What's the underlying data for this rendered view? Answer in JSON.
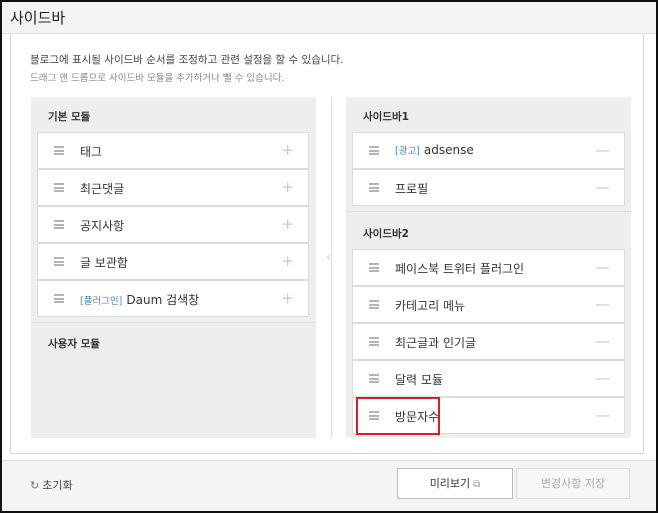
{
  "header": {
    "title": "사이드바"
  },
  "description": {
    "line1": "블로그에 표시될 사이드바 순서를 조정하고 관련 설정을 할 수 있습니다.",
    "line2": "드래그 앤 드롭으로 사이드바 모듈을 추가하거나 뺄 수 있습니다."
  },
  "basic_modules": {
    "label": "기본 모듈",
    "items": [
      {
        "tag": "",
        "label": "태그",
        "action": "+"
      },
      {
        "tag": "",
        "label": "최근댓글",
        "action": "+"
      },
      {
        "tag": "",
        "label": "공지사항",
        "action": "+"
      },
      {
        "tag": "",
        "label": "글 보관함",
        "action": "+"
      },
      {
        "tag": "[플러그인]",
        "label": "Daum 검색창",
        "action": "+"
      }
    ]
  },
  "user_modules": {
    "label": "사용자 모듈"
  },
  "sidebar1": {
    "label": "사이드바1",
    "items": [
      {
        "tag": "[광고]",
        "label": "adsense",
        "action": "—"
      },
      {
        "tag": "",
        "label": "프로필",
        "action": "—"
      }
    ]
  },
  "sidebar2": {
    "label": "사이드바2",
    "items": [
      {
        "tag": "",
        "label": "페이스북 트위터 플러그인",
        "action": "—"
      },
      {
        "tag": "",
        "label": "카테고리 메뉴",
        "action": "—"
      },
      {
        "tag": "",
        "label": "최근글과 인기글",
        "action": "—"
      },
      {
        "tag": "",
        "label": "달력 모듈",
        "action": "—"
      },
      {
        "tag": "",
        "label": "방문자수",
        "action": "—"
      }
    ]
  },
  "footer": {
    "reset_icon": "↻",
    "reset_label": "초기화",
    "preview_label": "미리보기",
    "preview_icon": "⧉",
    "save_label": "변경사항 저장"
  },
  "colors": {
    "highlight": "#e01b1b",
    "tag_blue": "#4a86c8"
  }
}
